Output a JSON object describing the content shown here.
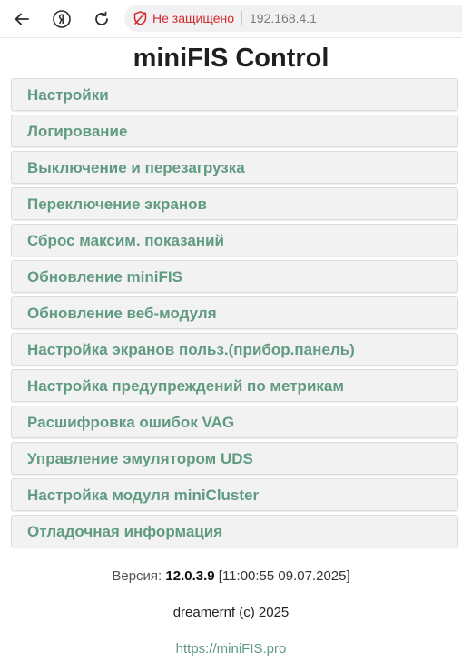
{
  "browser": {
    "security_label": "Не защищено",
    "url": "192.168.4.1",
    "security_color": "#d4282a"
  },
  "page": {
    "title": "miniFIS Control",
    "accent_color": "#609b82"
  },
  "menu": {
    "items": [
      {
        "label": "Настройки"
      },
      {
        "label": "Логирование"
      },
      {
        "label": "Выключение и перезагрузка"
      },
      {
        "label": "Переключение экранов"
      },
      {
        "label": "Сброс максим. показаний"
      },
      {
        "label": "Обновление miniFIS"
      },
      {
        "label": "Обновление веб-модуля"
      },
      {
        "label": "Настройка экранов польз.(прибор.панель)"
      },
      {
        "label": "Настройка предупреждений по метрикам"
      },
      {
        "label": "Расшифровка ошибок VAG"
      },
      {
        "label": "Управление эмулятором UDS"
      },
      {
        "label": "Настройка модуля miniCluster"
      },
      {
        "label": "Отладочная информация"
      }
    ]
  },
  "footer": {
    "version_label": "Версия:",
    "version_number": "12.0.3.9",
    "build_timestamp": "[11:00:55 09.07.2025]",
    "author": "dreamernf (c) 2025",
    "site_link": "https://miniFIS.pro"
  }
}
